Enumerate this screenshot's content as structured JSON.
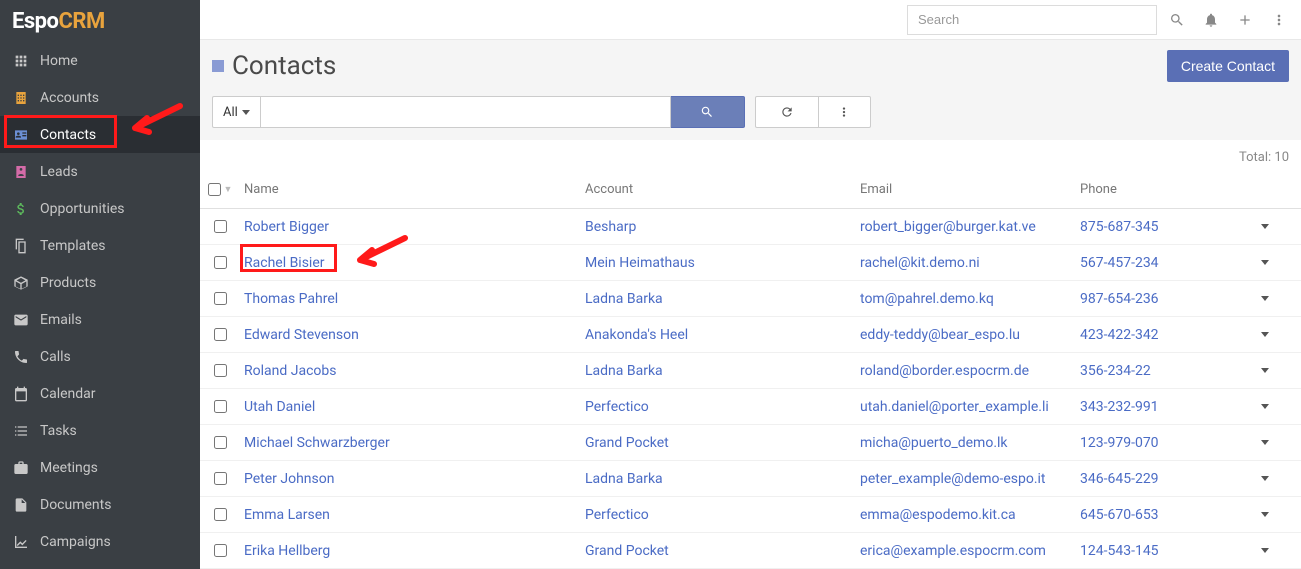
{
  "logo": {
    "part1": "Espo",
    "part2": "CRM"
  },
  "sidebar": {
    "items": [
      {
        "label": "Home",
        "slug": "home",
        "icon": "grid"
      },
      {
        "label": "Accounts",
        "slug": "accounts",
        "icon": "building"
      },
      {
        "label": "Contacts",
        "slug": "contacts",
        "icon": "id-card",
        "active": true
      },
      {
        "label": "Leads",
        "slug": "leads",
        "icon": "id-badge"
      },
      {
        "label": "Opportunities",
        "slug": "opportunities",
        "icon": "dollar"
      },
      {
        "label": "Templates",
        "slug": "templates",
        "icon": "copy"
      },
      {
        "label": "Products",
        "slug": "products",
        "icon": "box"
      },
      {
        "label": "Emails",
        "slug": "emails",
        "icon": "envelope"
      },
      {
        "label": "Calls",
        "slug": "calls",
        "icon": "phone"
      },
      {
        "label": "Calendar",
        "slug": "calendar",
        "icon": "calendar"
      },
      {
        "label": "Tasks",
        "slug": "tasks",
        "icon": "tasks"
      },
      {
        "label": "Meetings",
        "slug": "meetings",
        "icon": "briefcase"
      },
      {
        "label": "Documents",
        "slug": "documents",
        "icon": "file"
      },
      {
        "label": "Campaigns",
        "slug": "campaigns",
        "icon": "chart"
      }
    ]
  },
  "header": {
    "searchPlaceholder": "Search",
    "pageTitle": "Contacts",
    "createButton": "Create Contact"
  },
  "filter": {
    "scope": "All"
  },
  "table": {
    "totalLabel": "Total: 10",
    "columns": {
      "name": "Name",
      "account": "Account",
      "email": "Email",
      "phone": "Phone"
    },
    "rows": [
      {
        "name": "Robert Bigger",
        "account": "Besharp",
        "email": "robert_bigger@burger.kat.ve",
        "phone": "875-687-345"
      },
      {
        "name": "Rachel Bisier",
        "account": "Mein Heimathaus",
        "email": "rachel@kit.demo.ni",
        "phone": "567-457-234"
      },
      {
        "name": "Thomas Pahrel",
        "account": "Ladna Barka",
        "email": "tom@pahrel.demo.kq",
        "phone": "987-654-236"
      },
      {
        "name": "Edward Stevenson",
        "account": "Anakonda's Heel",
        "email": "eddy-teddy@bear_espo.lu",
        "phone": "423-422-342"
      },
      {
        "name": "Roland Jacobs",
        "account": "Ladna Barka",
        "email": "roland@border.espocrm.de",
        "phone": "356-234-22"
      },
      {
        "name": "Utah Daniel",
        "account": "Perfectico",
        "email": "utah.daniel@porter_example.li",
        "phone": "343-232-991"
      },
      {
        "name": "Michael Schwarzberger",
        "account": "Grand Pocket",
        "email": "micha@puerto_demo.lk",
        "phone": "123-979-070"
      },
      {
        "name": "Peter Johnson",
        "account": "Ladna Barka",
        "email": "peter_example@demo-espo.it",
        "phone": "346-645-229"
      },
      {
        "name": "Emma Larsen",
        "account": "Perfectico",
        "email": "emma@espodemo.kit.ca",
        "phone": "645-670-653"
      },
      {
        "name": "Erika Hellberg",
        "account": "Grand Pocket",
        "email": "erica@example.espocrm.com",
        "phone": "124-543-145"
      }
    ]
  },
  "iconColors": {
    "home": "#c8c8c8",
    "accounts": "#e8a33d",
    "contacts": "#6b8fd4",
    "leads": "#d46ba8",
    "opportunities": "#5cb85c",
    "templates": "#c8c8c8",
    "products": "#c8c8c8",
    "emails": "#c8c8c8",
    "calls": "#c8c8c8",
    "calendar": "#c8c8c8",
    "tasks": "#c8c8c8",
    "meetings": "#c8c8c8",
    "documents": "#c8c8c8",
    "campaigns": "#c8c8c8"
  }
}
